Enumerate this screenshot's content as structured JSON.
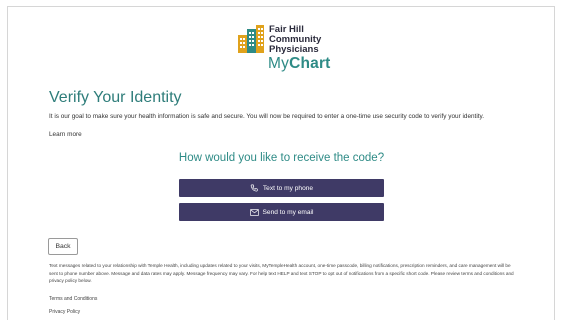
{
  "org": {
    "name_line1": "Fair Hill",
    "name_line2": "Community",
    "name_line3": "Physicians",
    "app_name_prefix": "My",
    "app_name_suffix": "Chart"
  },
  "page": {
    "title": "Verify Your Identity",
    "intro": "It is our goal to make sure your health information is safe and secure. You will now be required to enter a one-time use security code to verify your identity.",
    "learn_more": "Learn more",
    "question": "How would you like to receive the code?"
  },
  "options": {
    "phone_label": "Text to my phone",
    "phone_icon": "phone-icon",
    "email_label": "Send to my email",
    "email_icon": "envelope-icon"
  },
  "footer": {
    "back_label": "Back",
    "disclaimer": "Text messages related to your relationship with Temple Health, including updates related to your visits, MyTempleHealth account, one-time passcode, billing notifications, prescription reminders, and care management will be sent to phone number above. Message and data rates may apply. Message frequency may vary. For help text HELP and text STOP to opt out of notifications from a specific short code. Please review terms and conditions and privacy policy below.",
    "terms": "Terms and Conditions",
    "privacy": "Privacy Policy"
  },
  "colors": {
    "accent_teal": "#2e8b86",
    "button_purple": "#3f3a66",
    "logo_yellow": "#e0a21c",
    "logo_teal": "#2e8b86"
  }
}
